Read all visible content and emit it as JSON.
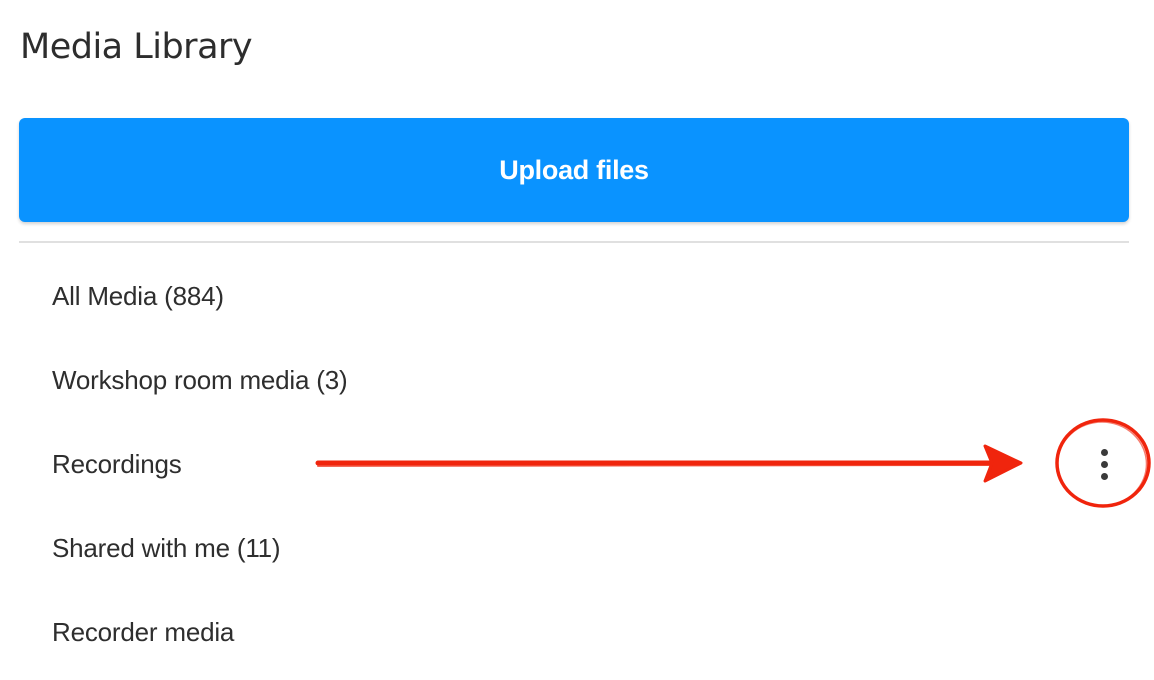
{
  "header": {
    "title": "Media Library"
  },
  "actions": {
    "upload_label": "Upload files"
  },
  "folders": [
    {
      "label": "All Media (884)"
    },
    {
      "label": "Workshop room media (3)"
    },
    {
      "label": "Recordings",
      "has_menu": true,
      "menu_icon": "more-vertical-icon"
    },
    {
      "label": "Shared with me (11)"
    },
    {
      "label": "Recorder media"
    }
  ],
  "annotation": {
    "color": "#f0250d",
    "kind": "arrow pointing to circled kebab menu"
  },
  "colors": {
    "accent": "#0a93ff",
    "text": "#2e2e2e",
    "divider": "#e0e0e0"
  }
}
